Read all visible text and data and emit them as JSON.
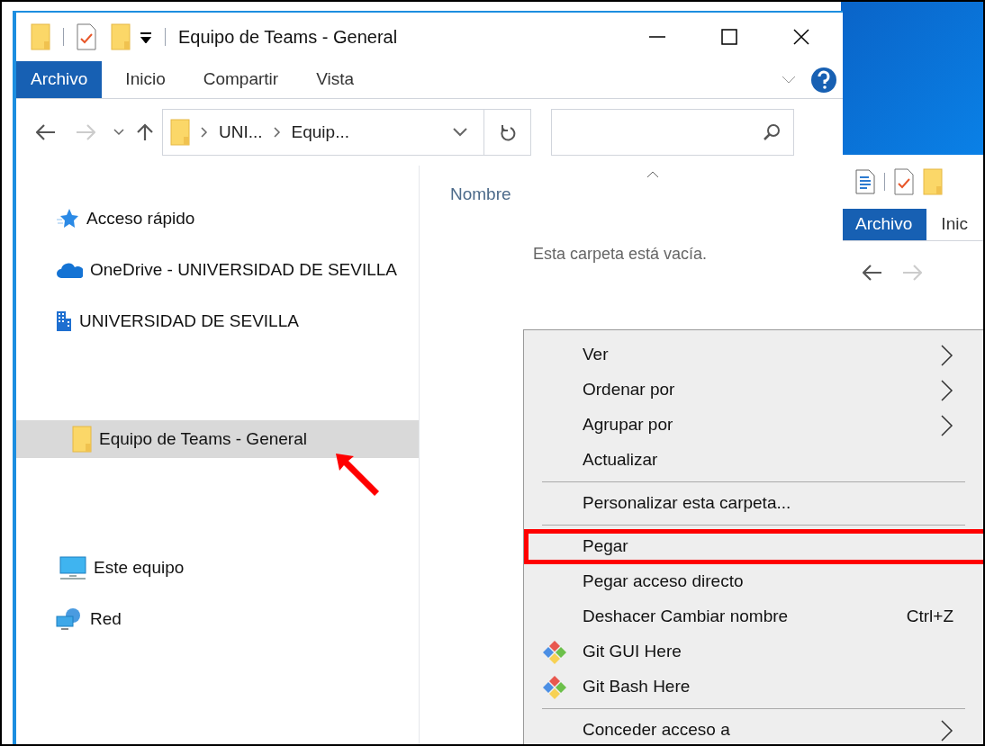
{
  "main_window": {
    "title": "Equipo de Teams - General",
    "ribbon_tabs": [
      {
        "label": "Archivo",
        "selected": true
      },
      {
        "label": "Inicio",
        "selected": false
      },
      {
        "label": "Compartir",
        "selected": false
      },
      {
        "label": "Vista",
        "selected": false
      }
    ],
    "address_segments": [
      "UNI...",
      "Equip..."
    ],
    "nav_items": [
      {
        "kind": "quick",
        "label": "Acceso rápido",
        "selected": false
      },
      {
        "kind": "cloud",
        "label": "OneDrive - UNIVERSIDAD DE SEVILLA",
        "selected": false
      },
      {
        "kind": "building",
        "label": "UNIVERSIDAD DE SEVILLA",
        "selected": false
      },
      {
        "kind": "folder",
        "label": "Equipo de Teams - General",
        "selected": true
      },
      {
        "kind": "computer",
        "label": "Este equipo",
        "selected": false
      },
      {
        "kind": "network",
        "label": "Red",
        "selected": false
      }
    ],
    "column": "Nombre",
    "empty_message": "Esta carpeta está vacía."
  },
  "second_window": {
    "ribbon_tabs": [
      {
        "label": "Archivo",
        "selected": true
      },
      {
        "label": "Inic",
        "selected": false
      }
    ]
  },
  "context_menu": {
    "items": [
      {
        "kind": "item",
        "label": "Ver",
        "submenu": true,
        "annotated": false
      },
      {
        "kind": "item",
        "label": "Ordenar por",
        "submenu": true,
        "annotated": false
      },
      {
        "kind": "item",
        "label": "Agrupar por",
        "submenu": true,
        "annotated": false
      },
      {
        "kind": "item",
        "label": "Actualizar",
        "submenu": false,
        "annotated": false
      },
      {
        "kind": "separator"
      },
      {
        "kind": "item",
        "label": "Personalizar esta carpeta...",
        "submenu": false,
        "annotated": false
      },
      {
        "kind": "separator"
      },
      {
        "kind": "item",
        "label": "Pegar",
        "submenu": false,
        "annotated": true
      },
      {
        "kind": "item",
        "label": "Pegar acceso directo",
        "submenu": false,
        "annotated": false
      },
      {
        "kind": "item",
        "label": "Deshacer Cambiar nombre",
        "shortcut": "Ctrl+Z",
        "submenu": false,
        "annotated": false
      },
      {
        "kind": "git",
        "label": "Git GUI Here",
        "submenu": false,
        "annotated": false
      },
      {
        "kind": "git",
        "label": "Git Bash Here",
        "submenu": false,
        "annotated": false
      },
      {
        "kind": "separator"
      },
      {
        "kind": "item",
        "label": "Conceder acceso a",
        "submenu": true,
        "annotated": false
      }
    ]
  }
}
